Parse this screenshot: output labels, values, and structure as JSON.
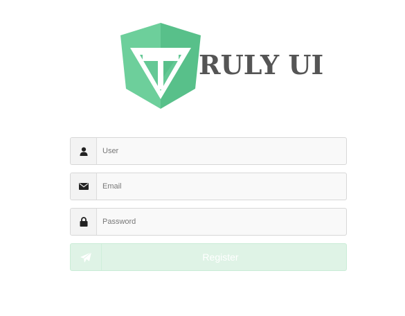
{
  "brand": {
    "logo_text": "RULY UI",
    "colors": {
      "shield_light": "#6dcf9b",
      "shield_dark": "#58c08a",
      "text": "#555555"
    }
  },
  "form": {
    "user": {
      "placeholder": "User",
      "value": "",
      "icon": "user-icon"
    },
    "email": {
      "placeholder": "Email",
      "value": "",
      "icon": "envelope-icon"
    },
    "password": {
      "placeholder": "Password",
      "value": "",
      "icon": "lock-icon"
    },
    "register": {
      "label": "Register",
      "icon": "paper-plane-icon",
      "color": "#dff3e6"
    }
  }
}
